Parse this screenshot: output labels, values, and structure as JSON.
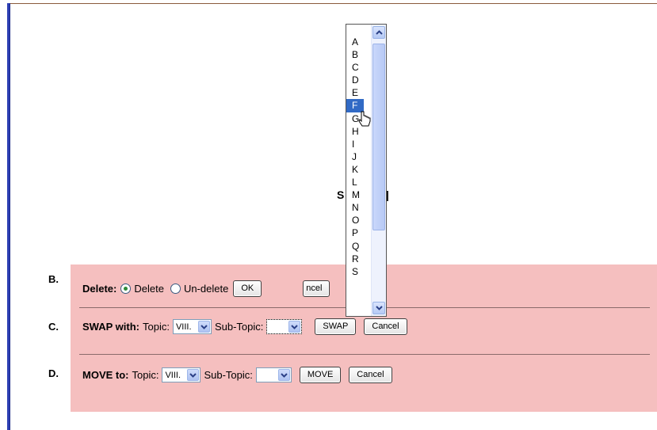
{
  "rows": {
    "b": {
      "label": "B.",
      "prefix": "Delete:",
      "option_delete": "Delete",
      "option_undelete": "Un-delete",
      "selected": "Delete",
      "ok_label": "OK",
      "cancel_partial": "ncel"
    },
    "c": {
      "label": "C.",
      "prefix": "SWAP with:",
      "topic_label": "Topic:",
      "topic_value": "VIII.",
      "subtopic_label": "Sub-Topic:",
      "subtopic_value": "",
      "action_label": "SWAP",
      "cancel_label": "Cancel"
    },
    "d": {
      "label": "D.",
      "prefix": "MOVE to:",
      "topic_label": "Topic:",
      "topic_value": "VIII.",
      "subtopic_label": "Sub-Topic:",
      "subtopic_value": "",
      "action_label": "MOVE",
      "cancel_label": "Cancel"
    }
  },
  "dropdown": {
    "options": [
      "A",
      "B",
      "C",
      "D",
      "E",
      "F",
      "G",
      "H",
      "I",
      "J",
      "K",
      "L",
      "M",
      "N",
      "O",
      "P",
      "Q",
      "R",
      "S"
    ],
    "highlighted": "F"
  },
  "icons": {
    "scroll_up": "chevron-up-icon",
    "scroll_down": "chevron-down-icon",
    "select_arrow": "chevron-down-icon",
    "cursor": "mouse-pointer-icon"
  },
  "colors": {
    "panel": "#f5bfbf",
    "selection": "#316ac5",
    "left_border": "#2d3fb4"
  }
}
